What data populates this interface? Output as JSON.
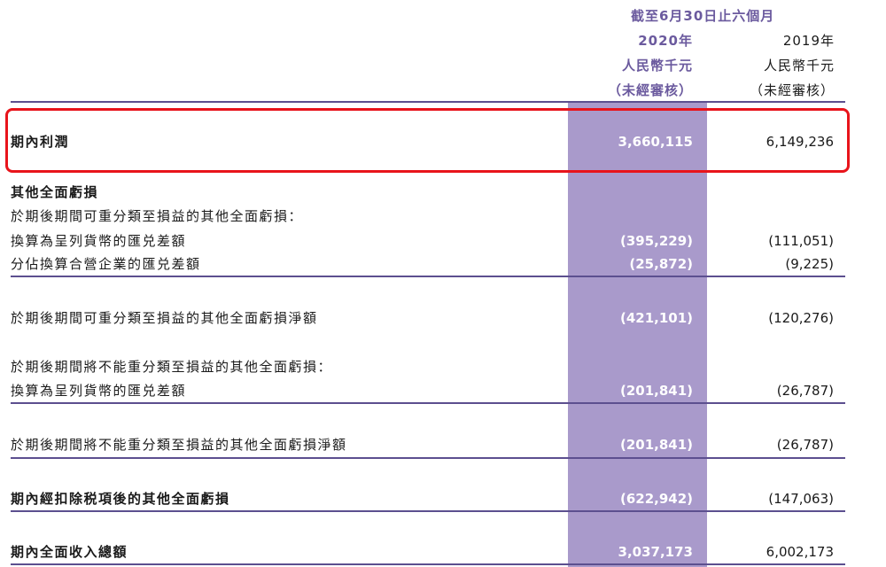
{
  "header": {
    "period": "截至6月30日止六個月",
    "col2020": {
      "year": "2020年",
      "unit": "人民幣千元",
      "audit": "（未經審核）"
    },
    "col2019": {
      "year": "2019年",
      "unit": "人民幣千元",
      "audit": "（未經審核）"
    }
  },
  "rows": [
    {
      "label": "期內利潤",
      "v2020": "3,660,115",
      "v2019": "6,149,236"
    },
    {
      "label": "其他全面虧損"
    },
    {
      "label": "於期後期間可重分類至損益的其他全面虧損："
    },
    {
      "label": "換算為呈列貨幣的匯兑差額",
      "v2020": "(395,229)",
      "v2019": "(111,051)"
    },
    {
      "label": "分佔換算合營企業的匯兑差額",
      "v2020": "(25,872)",
      "v2019": "(9,225)"
    },
    {
      "label": "於期後期間可重分類至損益的其他全面虧損淨額",
      "v2020": "(421,101)",
      "v2019": "(120,276)"
    },
    {
      "label": "於期後期間將不能重分類至損益的其他全面虧損："
    },
    {
      "label": "換算為呈列貨幣的匯兑差額",
      "v2020": "(201,841)",
      "v2019": "(26,787)"
    },
    {
      "label": "於期後期間將不能重分類至損益的其他全面虧損淨額",
      "v2020": "(201,841)",
      "v2019": "(26,787)"
    },
    {
      "label": "期內經扣除税項後的其他全面虧損",
      "v2020": "(622,942)",
      "v2019": "(147,063)"
    },
    {
      "label": "期內全面收入總額",
      "v2020": "3,037,173",
      "v2019": "6,002,173"
    }
  ],
  "colors": {
    "shade": "#a99acb",
    "rule": "#5c4f8f",
    "header_accent": "#6b5a9e",
    "highlight": "#e8141b"
  }
}
